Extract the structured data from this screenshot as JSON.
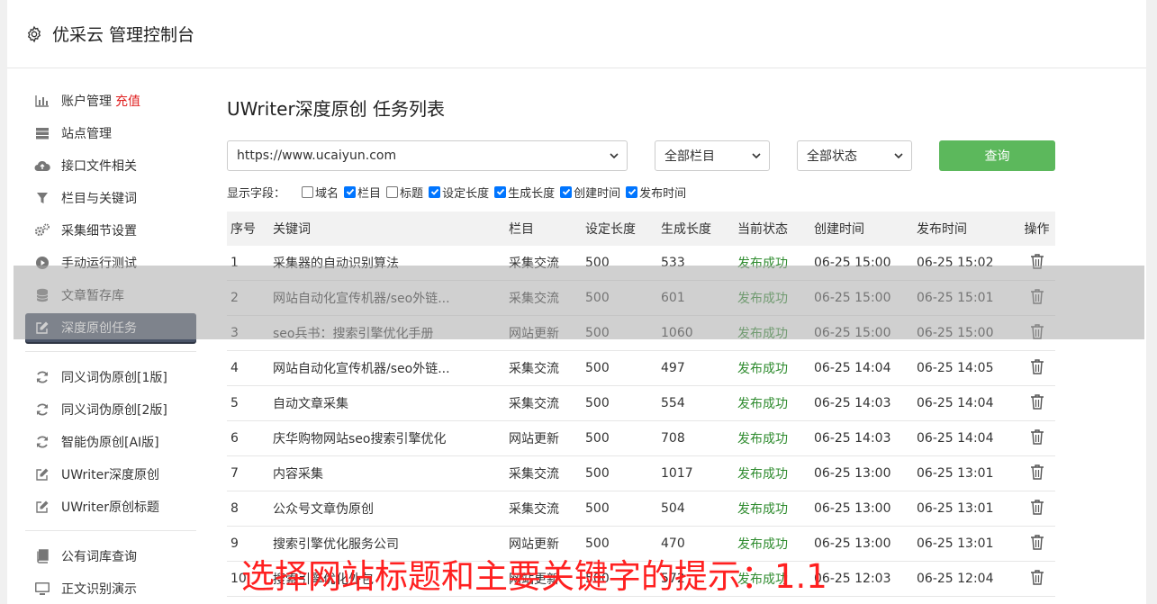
{
  "header": {
    "title": "优采云 管理控制台"
  },
  "sidebar": {
    "groups": [
      [
        {
          "icon": "bar-chart-icon",
          "label": "账户管理",
          "badge": "充值"
        },
        {
          "icon": "server-icon",
          "label": "站点管理"
        },
        {
          "icon": "cloud-upload-icon",
          "label": "接口文件相关"
        },
        {
          "icon": "filter-icon",
          "label": "栏目与关键词"
        },
        {
          "icon": "cogs-icon",
          "label": "采集细节设置"
        },
        {
          "icon": "play-circle-icon",
          "label": "手动运行测试"
        },
        {
          "icon": "database-icon",
          "label": "文章暂存库"
        },
        {
          "icon": "edit-icon",
          "label": "深度原创任务",
          "active": true
        }
      ],
      [
        {
          "icon": "refresh-icon",
          "label": "同义词伪原创[1版]"
        },
        {
          "icon": "refresh-icon",
          "label": "同义词伪原创[2版]"
        },
        {
          "icon": "refresh-icon",
          "label": "智能伪原创[AI版]"
        },
        {
          "icon": "edit-icon",
          "label": "UWriter深度原创"
        },
        {
          "icon": "edit-icon",
          "label": "UWriter原创标题"
        }
      ],
      [
        {
          "icon": "book-icon",
          "label": "公有词库查询"
        },
        {
          "icon": "monitor-icon",
          "label": "正文识别演示"
        }
      ]
    ]
  },
  "main": {
    "title": "UWriter深度原创 任务列表",
    "filters": {
      "site": "https://www.ucaiyun.com",
      "column": "全部栏目",
      "status": "全部状态",
      "query_label": "查询"
    },
    "fields_label": "显示字段：",
    "fields": [
      {
        "label": "域名",
        "checked": false
      },
      {
        "label": "栏目",
        "checked": true
      },
      {
        "label": "标题",
        "checked": false
      },
      {
        "label": "设定长度",
        "checked": true
      },
      {
        "label": "生成长度",
        "checked": true
      },
      {
        "label": "创建时间",
        "checked": true
      },
      {
        "label": "发布时间",
        "checked": true
      }
    ],
    "table": {
      "headers": [
        "序号",
        "关键词",
        "栏目",
        "设定长度",
        "生成长度",
        "当前状态",
        "创建时间",
        "发布时间",
        "操作"
      ],
      "rows": [
        [
          "1",
          "采集器的自动识别算法",
          "采集交流",
          "500",
          "533",
          "发布成功",
          "06-25 15:00",
          "06-25 15:02"
        ],
        [
          "2",
          "网站自动化宣传机器/seo外链...",
          "采集交流",
          "500",
          "601",
          "发布成功",
          "06-25 15:00",
          "06-25 15:01"
        ],
        [
          "3",
          "seo兵书：搜索引擎优化手册",
          "网站更新",
          "500",
          "1060",
          "发布成功",
          "06-25 15:00",
          "06-25 15:00"
        ],
        [
          "4",
          "网站自动化宣传机器/seo外链...",
          "采集交流",
          "500",
          "497",
          "发布成功",
          "06-25 14:04",
          "06-25 14:05"
        ],
        [
          "5",
          "自动文章采集",
          "采集交流",
          "500",
          "554",
          "发布成功",
          "06-25 14:03",
          "06-25 14:04"
        ],
        [
          "6",
          "庆华购物网站seo搜索引擎优化",
          "网站更新",
          "500",
          "708",
          "发布成功",
          "06-25 14:03",
          "06-25 14:04"
        ],
        [
          "7",
          "内容采集",
          "采集交流",
          "500",
          "1017",
          "发布成功",
          "06-25 13:00",
          "06-25 13:01"
        ],
        [
          "8",
          "公众号文章伪原创",
          "采集交流",
          "500",
          "504",
          "发布成功",
          "06-25 13:00",
          "06-25 13:01"
        ],
        [
          "9",
          "搜索引擎优化服务公司",
          "网站更新",
          "500",
          "470",
          "发布成功",
          "06-25 13:00",
          "06-25 13:01"
        ],
        [
          "10",
          "搜索引擎优化外包",
          "网站更新",
          "500",
          "572",
          "发布成功",
          "06-25 12:03",
          "06-25 12:04"
        ]
      ]
    }
  },
  "caption": "选择网站标题和主要关键字的提示：1.1"
}
